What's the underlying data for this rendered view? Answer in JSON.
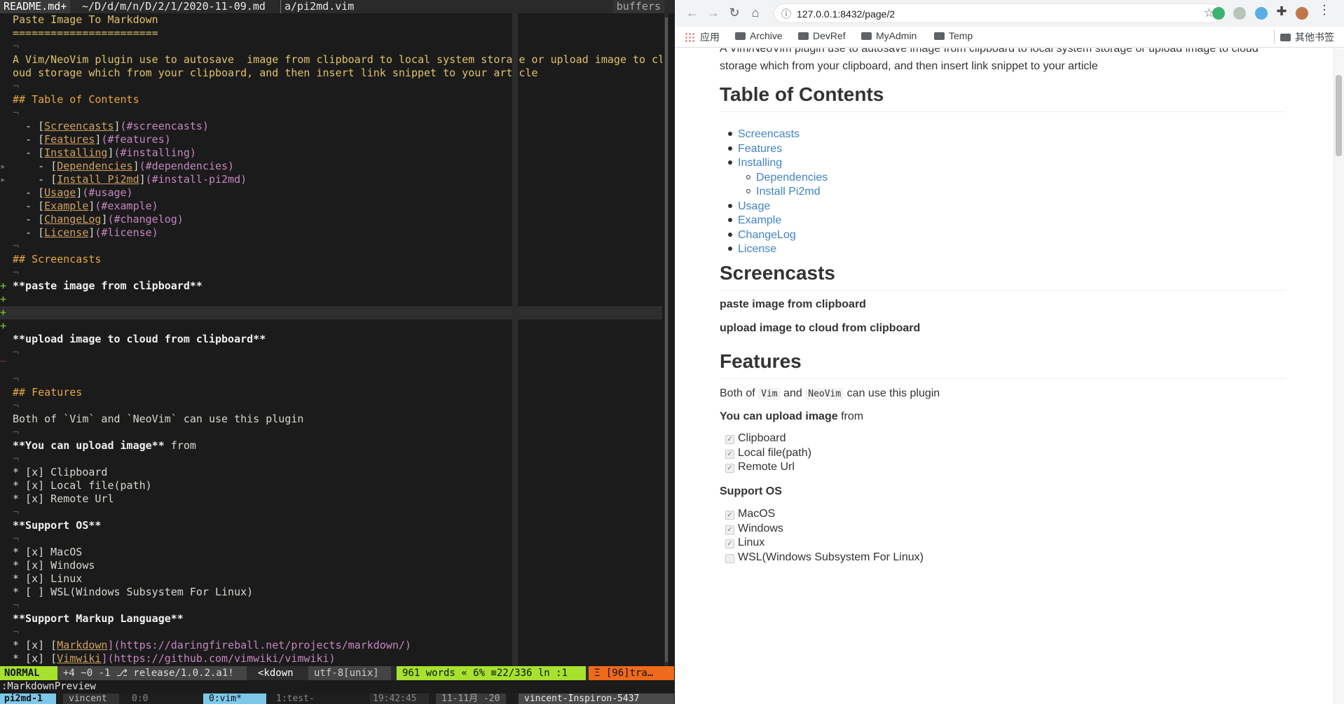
{
  "vim": {
    "tabs": {
      "active": "README.md+",
      "path": "~/D/d/m/n/D/2/1/2020-11-09.md",
      "file": "a/pi2md.vim",
      "buffers": "buffers"
    },
    "lines": {
      "l1": "Paste Image To Markdown",
      "l2": "=======================",
      "l3": "A Vim/NeoVim plugin use to autosave  image from clipboard to local system storage or upload image to cl",
      "l4": "oud storage which from your clipboard, and then insert link snippet to your article",
      "l5": "## Table of Contents",
      "toc": [
        {
          "indent": "  - ",
          "text": "Screencasts",
          "anchor": "(#screencasts)"
        },
        {
          "indent": "  - ",
          "text": "Features",
          "anchor": "(#features)"
        },
        {
          "indent": "  - ",
          "text": "Installing",
          "anchor": "(#installing)"
        },
        {
          "indent": "    - ",
          "text": "Dependencies",
          "anchor": "(#dependencies)"
        },
        {
          "indent": "    - ",
          "text": "Install Pi2md",
          "anchor": "(#install-pi2md)"
        },
        {
          "indent": "  - ",
          "text": "Usage",
          "anchor": "(#usage)"
        },
        {
          "indent": "  - ",
          "text": "Example",
          "anchor": "(#example)"
        },
        {
          "indent": "  - ",
          "text": "ChangeLog",
          "anchor": "(#changelog)"
        },
        {
          "indent": "  - ",
          "text": "License",
          "anchor": "(#license)"
        }
      ],
      "screencasts": "## Screencasts",
      "paste": "**paste image from clipboard**",
      "upload": "**upload image to cloud from clipboard**",
      "features": "## Features",
      "both": "Both of `Vim` and `NeoVim` can use this plugin",
      "youcan_b": "**You can upload image**",
      "youcan_r": " from",
      "items1": [
        "* [x] Clipboard",
        "* [x] Local file(path)",
        "* [x] Remote Url"
      ],
      "supportos": "**Support OS**",
      "items2": [
        "* [x] MacOS",
        "* [x] Windows",
        "* [x] Linux",
        "* [ ] WSL(Windows Subsystem For Linux)"
      ],
      "supportml": "**Support Markup Language**",
      "ml1_pre": "* [x] [",
      "ml1_name": "Markdown",
      "ml1_url": "](https://daringfireball.net/projects/markdown/)",
      "ml2_pre": "* [x] [",
      "ml2_name": "Vimwiki",
      "ml2_url": "](https://github.com/vimwiki/vimwiki)"
    },
    "status": {
      "mode": "NORMAL",
      "git": "+4 ~0 -1 ⎇ release/1.0.2.a1!",
      "ft": "<kdown",
      "enc": "utf-8[unix]",
      "pos": "961 words « 6% ≡22/336 ln :1",
      "warn": "Ξ [96]tra…"
    },
    "cmdline": ":MarkdownPreview",
    "tmux": {
      "session": "pi2md-1",
      "user": "vincent",
      "pane": "0:0",
      "win": "0:vim*",
      "win2": "1:test-",
      "time": "19:42:45",
      "date": "11-11月 -20",
      "host": "vincent-Inspiron-5437"
    }
  },
  "browser": {
    "url": "127.0.0.1:8432/page/2",
    "bookmarks": {
      "apps": "应用",
      "b1": "Archive",
      "b2": "DevRef",
      "b3": "MyAdmin",
      "b4": "Temp",
      "other": "其他书签"
    },
    "intro": "A Vim/NeoVim plugin use to autosave image from clipboard to local system storage or upload image to cloud storage which from your clipboard, and then insert link snippet to your article",
    "toc_title": "Table of Contents",
    "toc": [
      "Screencasts",
      "Features",
      "Installing",
      "Dependencies",
      "Install Pi2md",
      "Usage",
      "Example",
      "ChangeLog",
      "License"
    ],
    "screencasts_title": "Screencasts",
    "paste": "paste image from clipboard",
    "upload": "upload image to cloud from clipboard",
    "features_title": "Features",
    "both_pre": "Both of",
    "vim": "Vim",
    "and": "and",
    "neovim": "NeoVim",
    "both_post": "can use this plugin",
    "youcan_b": "You can upload image",
    "youcan_r": "from",
    "upload_items": [
      "Clipboard",
      "Local file(path)",
      "Remote Url"
    ],
    "supportos": "Support OS",
    "os_items": [
      "MacOS",
      "Windows",
      "Linux",
      "WSL(Windows Subsystem For Linux)"
    ],
    "os_checked": [
      true,
      true,
      true,
      false
    ]
  }
}
